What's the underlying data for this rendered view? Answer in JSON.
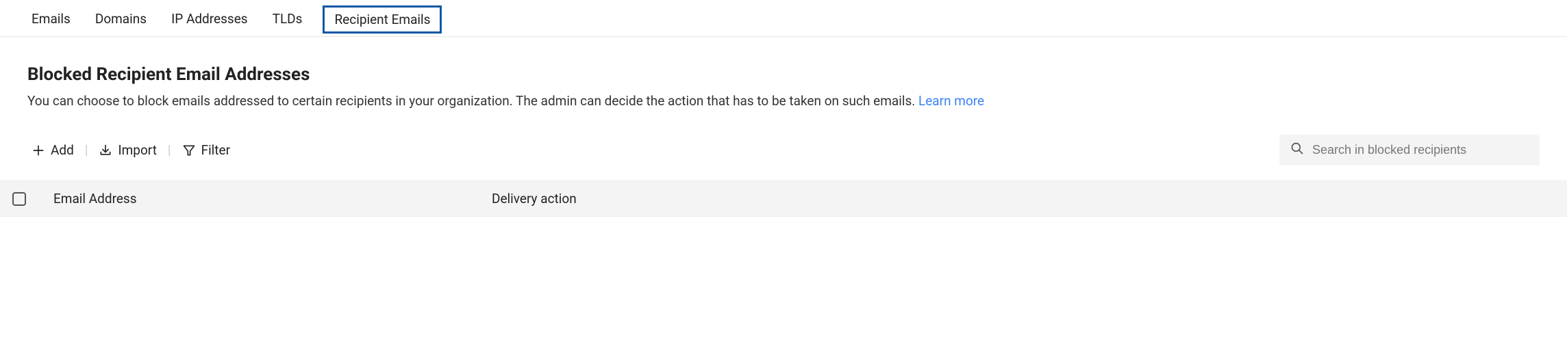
{
  "tabs": {
    "emails": "Emails",
    "domains": "Domains",
    "ip": "IP Addresses",
    "tlds": "TLDs",
    "recipient": "Recipient Emails"
  },
  "page": {
    "heading": "Blocked Recipient Email Addresses",
    "description": "You can choose to block emails addressed to certain recipients in your organization. The admin can decide the action that has to be taken on such emails. ",
    "learn_more": "Learn more"
  },
  "toolbar": {
    "add": "Add",
    "import": "Import",
    "filter": "Filter"
  },
  "search": {
    "placeholder": "Search in blocked recipients"
  },
  "table": {
    "col_email": "Email Address",
    "col_action": "Delivery action"
  }
}
